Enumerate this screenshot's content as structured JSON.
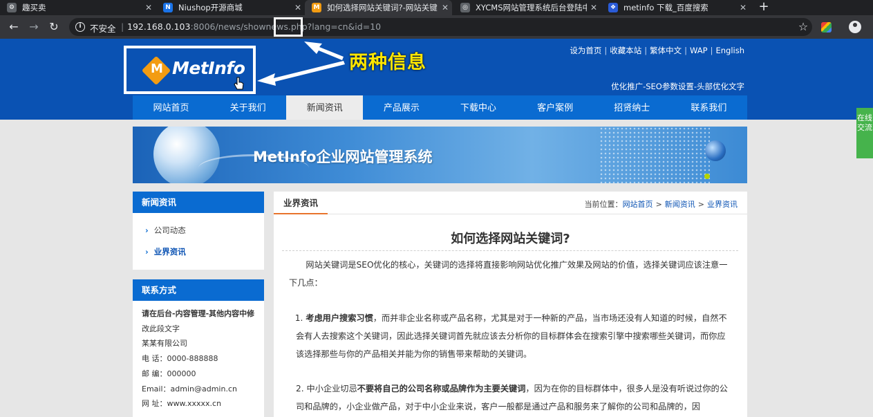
{
  "browser": {
    "tabs": [
      {
        "title": "趣买卖",
        "favicon_color": "#9aa0a6"
      },
      {
        "title": "Niushop开源商城",
        "favicon_color": "#1a73e8"
      },
      {
        "title": "如何选择网站关键词?-网站关键",
        "favicon_color": "#f39c12"
      },
      {
        "title": "XYCMS网站管理系统后台登陆中",
        "favicon_color": "#5f6368"
      },
      {
        "title": "metinfo 下载_百度搜索",
        "favicon_color": "#2a5bd7"
      }
    ],
    "favicon_glyphs": [
      "⚙",
      "N",
      "M",
      "◎",
      "❖"
    ],
    "security_label": "不安全",
    "url_host": "192.168.0.103",
    "url_rest": ":8006/news/shownews.php?lang=cn&id=10"
  },
  "site": {
    "logo_text": "MetInfo",
    "logo_mark": "M",
    "top_links": [
      "设为首页",
      "收藏本站",
      "繁体中文",
      "WAP",
      "English"
    ],
    "seo_text": "优化推广-SEO参数设置-头部优化文字",
    "nav": [
      "网站首页",
      "关于我们",
      "新闻资讯",
      "产品展示",
      "下载中心",
      "客户案例",
      "招贤纳士",
      "联系我们"
    ],
    "nav_active_index": 2,
    "banner_title": "MetInfo企业网站管理系统"
  },
  "annotation": {
    "label": "两种信息"
  },
  "sidebar": {
    "news_title": "新闻资讯",
    "news_links": [
      "公司动态",
      "业界资讯"
    ],
    "contact_title": "联系方式",
    "contact_lines": [
      "请在后台-内容管理-其他内容中修",
      "改此段文字",
      "某某有限公司",
      "电  话：0000-888888",
      "邮  编：000000",
      "Email：admin@admin.cn",
      "网  址：www.xxxxx.cn"
    ]
  },
  "main": {
    "tab_label": "业界资讯",
    "crumb_prefix": "当前位置：",
    "crumbs": [
      "网站首页",
      "新闻资讯",
      "业界资讯"
    ],
    "article_title": "如何选择网站关键词?",
    "para_intro": "网站关键词是SEO优化的核心，关键词的选择将直接影响网站优化推广效果及网站的价值，选择关键词应该注意一下几点：",
    "point1_prefix": "1. ",
    "point1_bold": "考虑用户搜索习惯",
    "point1_rest": "，而并非企业名称或产品名称，尤其是对于一种新的产品，当市场还没有人知道的时候，自然不会有人去搜索这个关键词，因此选择关键词首先就应该去分析你的目标群体会在搜索引擎中搜索哪些关键词，而你应该选择那些与你的产品相关并能为你的销售带来帮助的关键词。",
    "point2_prefix": "2. 中小企业切忌",
    "point2_bold": "不要将自己的公司名称或品牌作为主要关键词",
    "point2_rest": "，因为在你的目标群体中，很多人是没有听说过你的公司和品牌的，小企业做产品，对于中小企业来说，客户一般都是通过产品和服务来了解你的公司和品牌的，因"
  },
  "float_tab": "在线交流"
}
